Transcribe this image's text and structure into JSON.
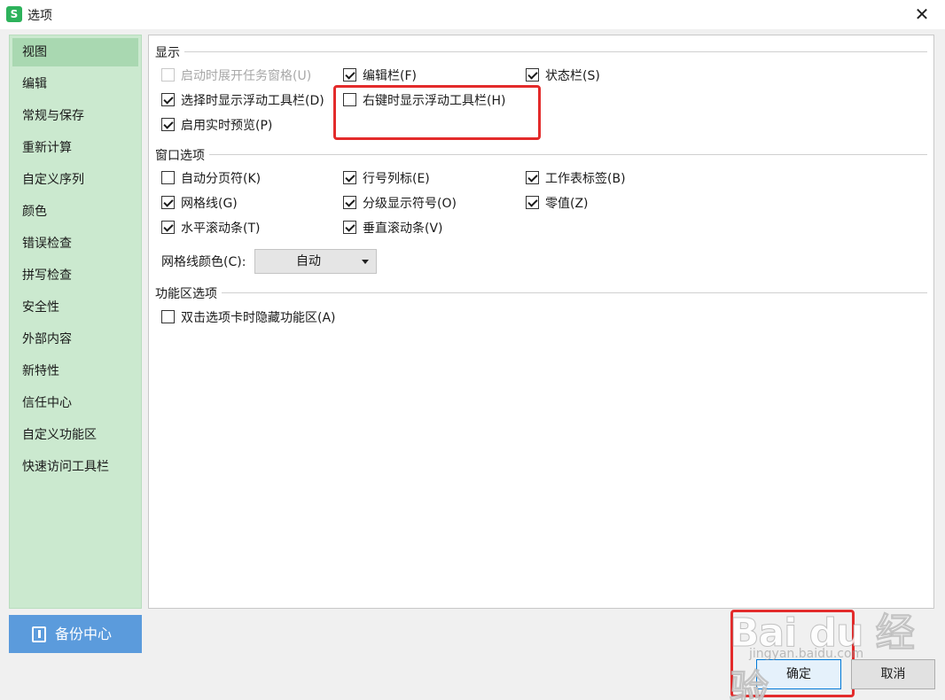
{
  "window": {
    "title": "选项",
    "app_icon_letter": "S"
  },
  "sidebar": {
    "items": [
      {
        "label": "视图",
        "active": true
      },
      {
        "label": "编辑"
      },
      {
        "label": "常规与保存"
      },
      {
        "label": "重新计算"
      },
      {
        "label": "自定义序列"
      },
      {
        "label": "颜色"
      },
      {
        "label": "错误检查"
      },
      {
        "label": "拼写检查"
      },
      {
        "label": "安全性"
      },
      {
        "label": "外部内容"
      },
      {
        "label": "新特性"
      },
      {
        "label": "信任中心"
      },
      {
        "label": "自定义功能区"
      },
      {
        "label": "快速访问工具栏"
      }
    ],
    "backup_label": "备份中心"
  },
  "display": {
    "title": "显示",
    "options": [
      {
        "label": "启动时展开任务窗格(U)",
        "checked": false,
        "disabled": true
      },
      {
        "label": "编辑栏(F)",
        "checked": true
      },
      {
        "label": "状态栏(S)",
        "checked": true
      },
      {
        "label": "选择时显示浮动工具栏(D)",
        "checked": true
      },
      {
        "label": "右键时显示浮动工具栏(H)",
        "checked": false
      },
      {
        "label": "启用实时预览(P)",
        "checked": true
      }
    ]
  },
  "window_options": {
    "title": "窗口选项",
    "options": [
      {
        "label": "自动分页符(K)",
        "checked": false
      },
      {
        "label": "行号列标(E)",
        "checked": true
      },
      {
        "label": "工作表标签(B)",
        "checked": true
      },
      {
        "label": "网格线(G)",
        "checked": true
      },
      {
        "label": "分级显示符号(O)",
        "checked": true
      },
      {
        "label": "零值(Z)",
        "checked": true
      },
      {
        "label": "水平滚动条(T)",
        "checked": true
      },
      {
        "label": "垂直滚动条(V)",
        "checked": true
      }
    ],
    "gridline_color_label": "网格线颜色(C):",
    "gridline_color_value": "自动"
  },
  "ribbon": {
    "title": "功能区选项",
    "options": [
      {
        "label": "双击选项卡时隐藏功能区(A)",
        "checked": false
      }
    ]
  },
  "buttons": {
    "ok": "确定",
    "cancel": "取消"
  },
  "watermark": {
    "text": "Bai du 经验",
    "sub": "jingyan.baidu.com"
  },
  "colors": {
    "sidebar_bg": "#cbe9cf",
    "sidebar_active": "#a9d8b1",
    "backup_bg": "#5b9bdc",
    "highlight": "#e32b2b",
    "ok_border": "#0078d7"
  }
}
